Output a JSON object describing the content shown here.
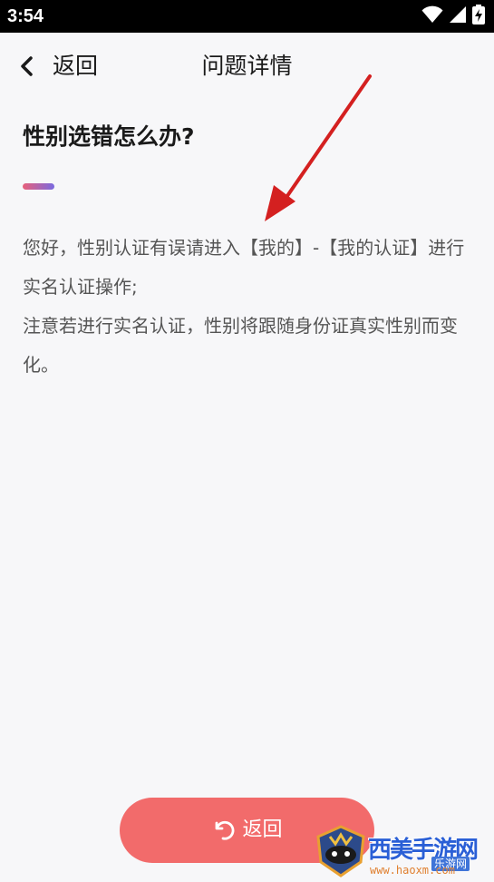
{
  "status_bar": {
    "time": "3:54",
    "icons": [
      "wifi-icon",
      "signal-icon",
      "battery-icon"
    ]
  },
  "header": {
    "back_label": "返回",
    "title": "问题详情"
  },
  "question": {
    "title": "性别选错怎么办?",
    "accent_colors": [
      "#e8607a",
      "#7a6ae0"
    ]
  },
  "answer": {
    "paragraphs": [
      "您好，性别认证有误请进入【我的】-【我的认证】进行实名认证操作;",
      "注意若进行实名认证，性别将跟随身份证真实性别而变化。"
    ]
  },
  "bottom_button": {
    "label": "返回",
    "color": "#f26b6b"
  },
  "watermark": {
    "brand": "西美手游网",
    "sub": "乐游网",
    "url": "www.haoxm.com"
  }
}
